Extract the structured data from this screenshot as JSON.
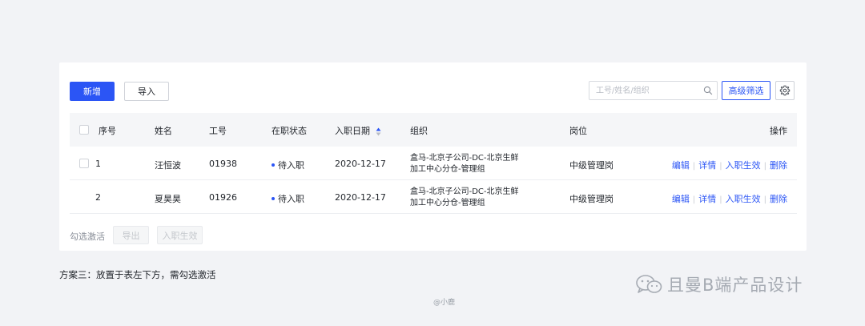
{
  "toolbar": {
    "add_label": "新增",
    "import_label": "导入",
    "search_placeholder": "工号/姓名/组织",
    "advanced_filter_label": "高级筛选"
  },
  "table": {
    "columns": {
      "index": "序号",
      "name": "姓名",
      "id": "工号",
      "status": "在职状态",
      "date": "入职日期",
      "org": "组织",
      "position": "岗位",
      "actions": "操作"
    },
    "rows": [
      {
        "index": "1",
        "name": "汪恒波",
        "id": "01938",
        "status": "待入职",
        "date": "2020-12-17",
        "org_line1": "盒马-北京子公司-DC-北京生鲜",
        "org_line2": "加工中心分仓-管理组",
        "position": "中级管理岗"
      },
      {
        "index": "2",
        "name": "夏昊昊",
        "id": "01926",
        "status": "待入职",
        "date": "2020-12-17",
        "org_line1": "盒马-北京子公司-DC-北京生鲜",
        "org_line2": "加工中心分仓-管理组",
        "position": "中级管理岗"
      }
    ],
    "row_actions": {
      "edit": "编辑",
      "detail": "详情",
      "activate": "入职生效",
      "delete": "删除",
      "separator": "|"
    }
  },
  "footer": {
    "hint": "勾选激活",
    "export_label": "导出",
    "activate_label": "入职生效"
  },
  "caption": "方案三：放置于表左下方，需勾选激活",
  "credit": "@小鹿",
  "watermark": "且曼B端产品设计",
  "colors": {
    "primary": "#2b55f5",
    "background": "#f2f3f6",
    "header_bg": "#f5f6f8"
  }
}
